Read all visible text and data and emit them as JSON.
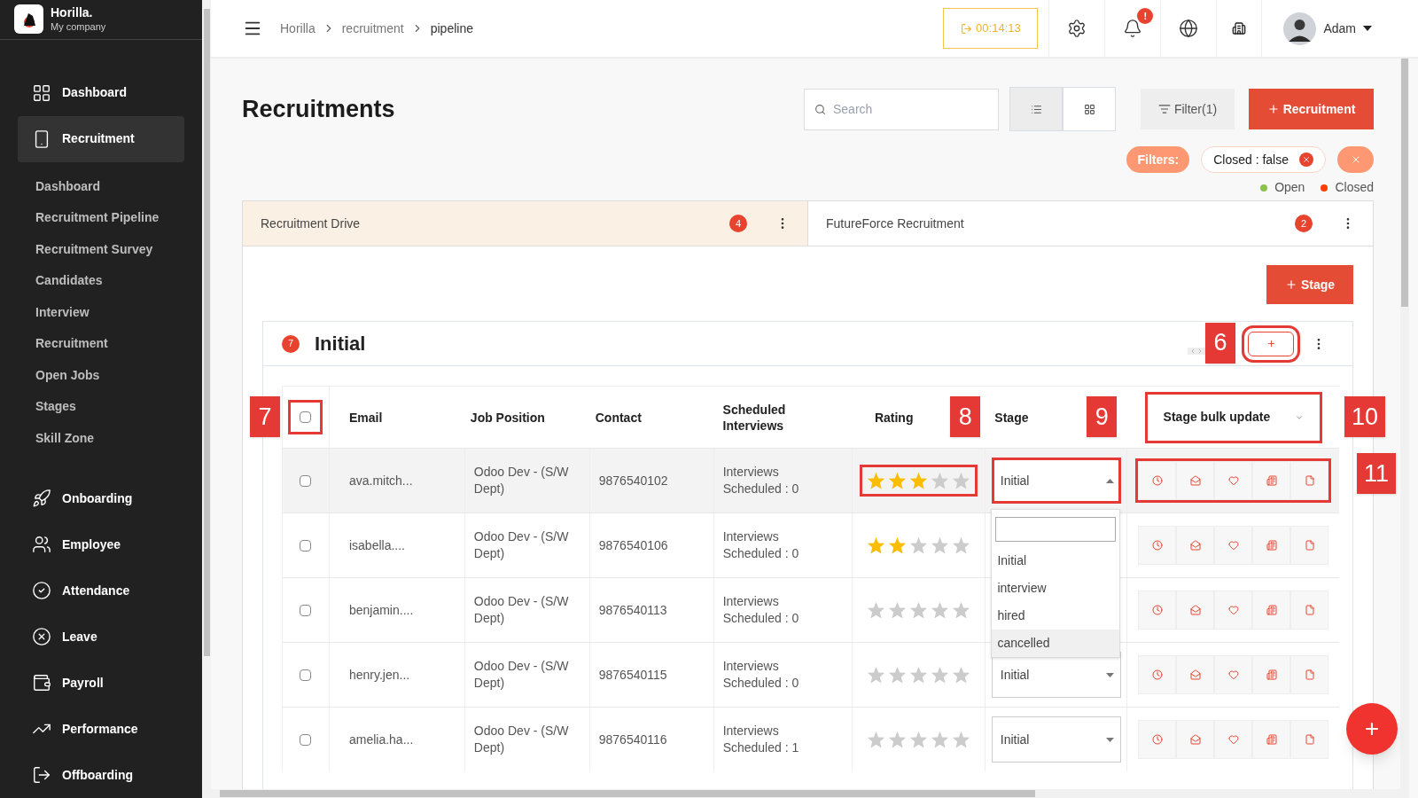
{
  "sidebar": {
    "brand": {
      "name": "Horilla.",
      "company": "My company"
    },
    "items": [
      {
        "label": "Dashboard",
        "selected": false
      },
      {
        "label": "Recruitment",
        "selected": true,
        "children": [
          {
            "label": "Dashboard"
          },
          {
            "label": "Recruitment Pipeline"
          },
          {
            "label": "Recruitment Survey"
          },
          {
            "label": "Candidates"
          },
          {
            "label": "Interview"
          },
          {
            "label": "Recruitment"
          },
          {
            "label": "Open Jobs"
          },
          {
            "label": "Stages"
          },
          {
            "label": "Skill Zone"
          }
        ]
      },
      {
        "label": "Onboarding",
        "selected": false
      },
      {
        "label": "Employee",
        "selected": false
      },
      {
        "label": "Attendance",
        "selected": false
      },
      {
        "label": "Leave",
        "selected": false
      },
      {
        "label": "Payroll",
        "selected": false
      },
      {
        "label": "Performance",
        "selected": false
      },
      {
        "label": "Offboarding",
        "selected": false
      }
    ]
  },
  "header": {
    "breadcrumb": [
      "Horilla",
      "recruitment",
      "pipeline"
    ],
    "timer": "00:14:13",
    "notification_badge": "!",
    "user": "Adam"
  },
  "page": {
    "title": "Recruitments",
    "search": {
      "placeholder": "Search"
    },
    "views": [
      {
        "kind": "list",
        "selected": true
      },
      {
        "kind": "grid",
        "selected": false
      }
    ],
    "filter_button": "Filter(1)",
    "add_button": "Recruitment",
    "filters_label": "Filters:",
    "filter_chips": [
      "Closed : false"
    ],
    "legend": [
      {
        "label": "Open",
        "color": "#8bc34a"
      },
      {
        "label": "Closed",
        "color": "#ff3d00"
      }
    ]
  },
  "tabs": [
    {
      "label": "Recruitment Drive",
      "count": "4",
      "selected": true
    },
    {
      "label": "FutureForce Recruitment",
      "count": "2",
      "selected": false
    }
  ],
  "stage_button": "Stage",
  "stage": {
    "count": "7",
    "title": "Initial",
    "columns": [
      "Email",
      "Job Position",
      "Contact",
      "Scheduled Interviews",
      "Rating",
      "Stage"
    ],
    "bulk_update": "Stage bulk update",
    "select_all": {
      "checked": false
    },
    "rows": [
      {
        "email": "ava.mitch...",
        "job": "Odoo Dev - (S/W Dept)",
        "contact": "9876540102",
        "interviews": "Interviews Scheduled : 0",
        "stars": 3,
        "checked": false,
        "hovered": true,
        "outlined": true,
        "stage": "Initial",
        "open": true,
        "dropdown": [
          {
            "label": "Initial",
            "highlighted": false
          },
          {
            "label": "interview",
            "highlighted": false
          },
          {
            "label": "hired",
            "highlighted": false
          },
          {
            "label": "cancelled",
            "highlighted": true
          }
        ]
      },
      {
        "email": "isabella....",
        "job": "Odoo Dev - (S/W Dept)",
        "contact": "9876540106",
        "interviews": "Interviews Scheduled : 0",
        "stars": 2,
        "checked": false,
        "hovered": false,
        "outlined": false
      },
      {
        "email": "benjamin....",
        "job": "Odoo Dev - (S/W Dept)",
        "contact": "9876540113",
        "interviews": "Interviews Scheduled : 0",
        "stars": 0,
        "checked": false,
        "hovered": false,
        "outlined": false
      },
      {
        "email": "henry.jen...",
        "job": "Odoo Dev - (S/W Dept)",
        "contact": "9876540115",
        "interviews": "Interviews Scheduled : 0",
        "stars": 0,
        "checked": false,
        "hovered": false,
        "outlined": false,
        "stage": "Initial",
        "open": false
      },
      {
        "email": "amelia.ha...",
        "job": "Odoo Dev - (S/W Dept)",
        "contact": "9876540116",
        "interviews": "Interviews Scheduled : 1",
        "stars": 0,
        "checked": false,
        "hovered": false,
        "outlined": false,
        "stage": "Initial",
        "open": false
      }
    ]
  },
  "callouts": {
    "add_button": "6",
    "select_all": "7",
    "rating": "8",
    "stage": "9",
    "bulk_update": "10",
    "actions": "11"
  },
  "fab": "+"
}
